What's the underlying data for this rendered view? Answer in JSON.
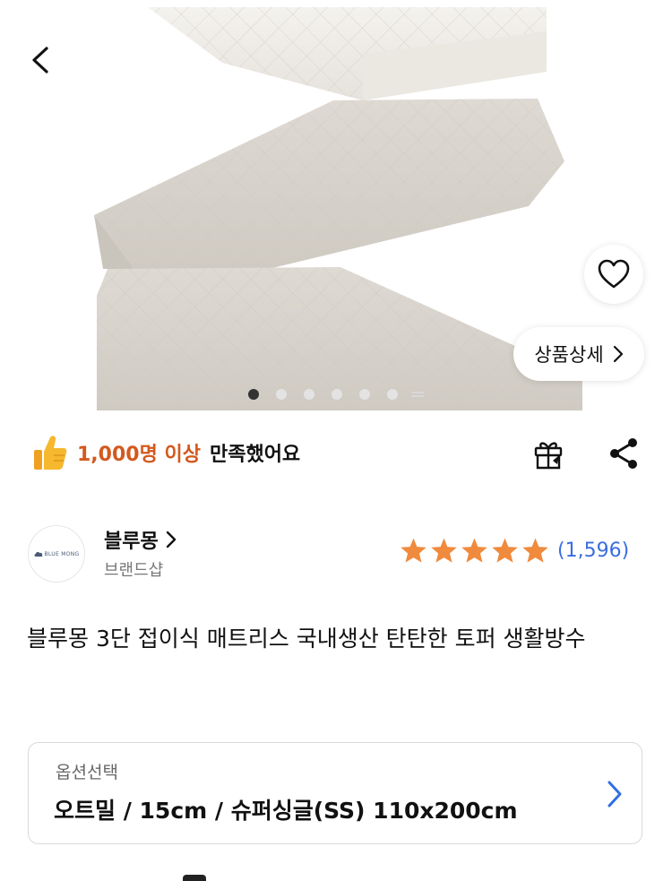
{
  "nav": {
    "back_icon": "chevron-left-icon"
  },
  "gallery": {
    "image_alt": "folded quilted mattress",
    "total_dots": 6,
    "active_index": 0,
    "wishlist_icon": "heart-outline-icon",
    "detail_button_label": "상품상세",
    "detail_button_icon": "chevron-right-icon"
  },
  "satisfaction": {
    "icon": "thumbs-up-icon",
    "count_text": "1,000명 이상",
    "rest_text": "만족했어요"
  },
  "actions": {
    "gift_icon": "gift-icon",
    "share_icon": "share-icon"
  },
  "brand": {
    "logo_text": "BLUE MONG",
    "name": "블루몽",
    "type": "브랜드샵"
  },
  "rating": {
    "stars": 5,
    "count_text": "(1,596)",
    "star_color": "#f08a3c"
  },
  "product": {
    "title": "블루몽 3단 접이식 매트리스 국내생산 탄탄한 토퍼 생활방수"
  },
  "option": {
    "label": "옵션선택",
    "value": "오트밀 / 15cm / 슈퍼싱글(SS) 110x200cm",
    "arrow_color": "#2f6fe3"
  },
  "colors": {
    "accent_orange": "#d3591e",
    "link_blue": "#3a6ee0"
  }
}
